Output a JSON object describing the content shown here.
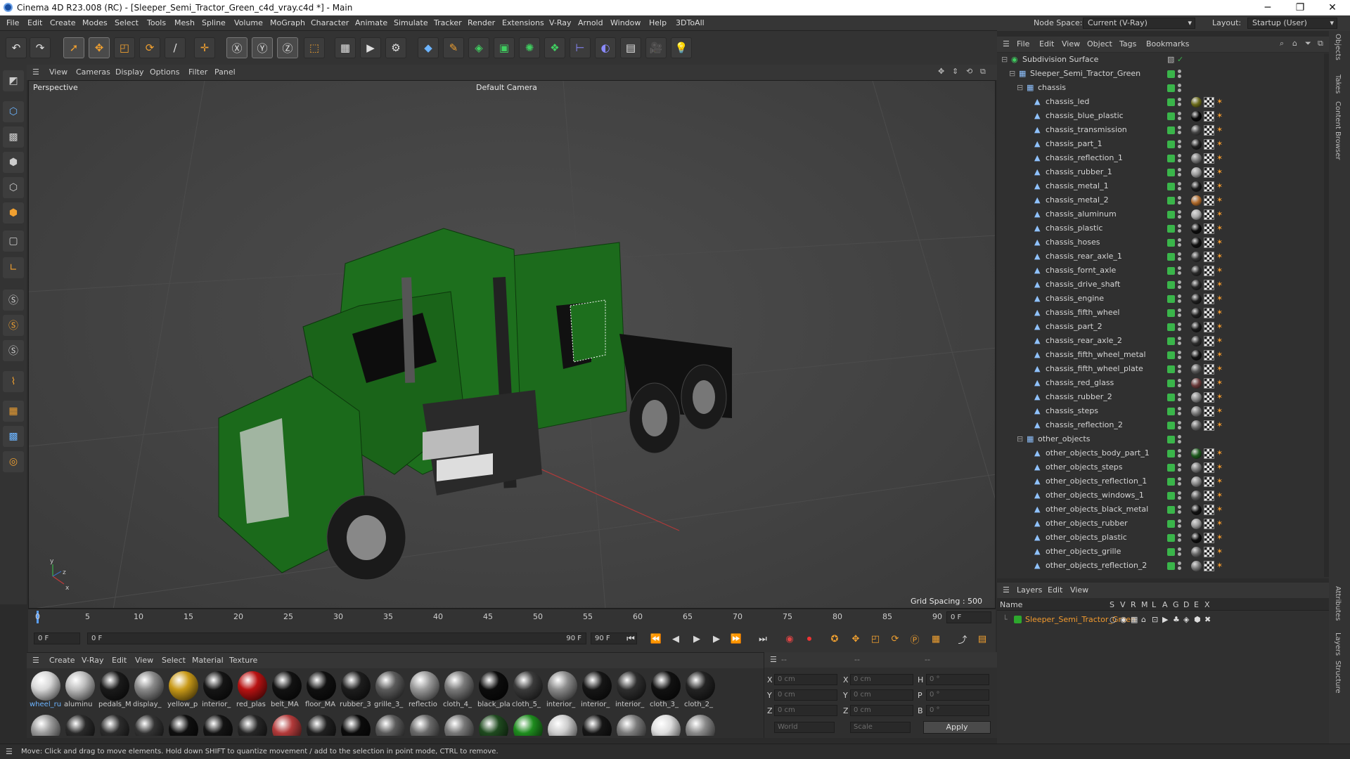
{
  "window": {
    "title": "Cinema 4D R23.008 (RC) - [Sleeper_Semi_Tractor_Green_c4d_vray.c4d *] - Main",
    "min": "─",
    "max": "❐",
    "close": "✕"
  },
  "menubar": [
    "File",
    "Edit",
    "Create",
    "Modes",
    "Select",
    "Tools",
    "Mesh",
    "Spline",
    "Volume",
    "MoGraph",
    "Character",
    "Animate",
    "Simulate",
    "Tracker",
    "Render",
    "Extensions",
    "V-Ray",
    "Arnold",
    "Window",
    "Help",
    "3DToAll"
  ],
  "nodespace": {
    "label": "Node Space:",
    "value": "Current (V-Ray)",
    "layout_label": "Layout:",
    "layout_value": "Startup (User)"
  },
  "viewport": {
    "menu": [
      "View",
      "Cameras",
      "Display",
      "Options",
      "Filter",
      "Panel"
    ],
    "name": "Perspective",
    "camera": "Default Camera",
    "grid_spacing": "Grid Spacing : 500 cm"
  },
  "timeline": {
    "ticks": [
      "0",
      "5",
      "10",
      "15",
      "20",
      "25",
      "30",
      "35",
      "40",
      "45",
      "50",
      "55",
      "60",
      "65",
      "70",
      "75",
      "80",
      "85",
      "90"
    ],
    "end_frame": "0 F",
    "start_field": "0 F",
    "current_field": "0 F",
    "range_end": "90 F",
    "max_field": "90 F"
  },
  "materials": {
    "menu": [
      "Create",
      "V-Ray",
      "Edit",
      "View",
      "Select",
      "Material",
      "Texture"
    ],
    "row1": [
      {
        "label": "wheel_ru",
        "color": "#d8d8d8"
      },
      {
        "label": "aluminu",
        "color": "#bdbdbd"
      },
      {
        "label": "pedals_M",
        "color": "#1a1a1a"
      },
      {
        "label": "display_",
        "color": "#8a8a8a"
      },
      {
        "label": "yellow_p",
        "color": "#c99a18"
      },
      {
        "label": "interior_",
        "color": "#151515"
      },
      {
        "label": "red_plas",
        "color": "#b81212"
      },
      {
        "label": "belt_MA",
        "color": "#121212"
      },
      {
        "label": "floor_MA",
        "color": "#101010"
      },
      {
        "label": "rubber_3",
        "color": "#1d1d1d"
      },
      {
        "label": "grille_3_",
        "color": "#5b5b5b"
      },
      {
        "label": "reflectio",
        "color": "#9a9a9a"
      },
      {
        "label": "cloth_4_",
        "color": "#7a7a7a"
      },
      {
        "label": "black_pla",
        "color": "#0c0c0c"
      },
      {
        "label": "cloth_5_",
        "color": "#3a3a3a"
      },
      {
        "label": "interior_",
        "color": "#8c8c8c"
      },
      {
        "label": "interior_",
        "color": "#161616"
      },
      {
        "label": "interior_",
        "color": "#2e2e2e"
      },
      {
        "label": "cloth_3_",
        "color": "#111111"
      },
      {
        "label": "cloth_2_",
        "color": "#232323"
      }
    ],
    "row2": [
      "#9a9a9a",
      "#2a2a2a",
      "#2c2c2c",
      "#333333",
      "#0f0f0f",
      "#141414",
      "#262626",
      "#b23a3a",
      "#202020",
      "#0b0b0b",
      "#5a5a5a",
      "#6a6a6a",
      "#777777",
      "#1f4a1f",
      "#1e8c1e",
      "#cccccc",
      "#161616",
      "#7a7a7a",
      "#dddddd",
      "#888888"
    ]
  },
  "coords": {
    "headers": [
      "--",
      "--",
      "--"
    ],
    "rows": [
      {
        "a": "X",
        "av": "0 cm",
        "b": "X",
        "bv": "0 cm",
        "c": "H",
        "cv": "0 °"
      },
      {
        "a": "Y",
        "av": "0 cm",
        "b": "Y",
        "bv": "0 cm",
        "c": "P",
        "cv": "0 °"
      },
      {
        "a": "Z",
        "av": "0 cm",
        "b": "Z",
        "bv": "0 cm",
        "c": "B",
        "cv": "0 °"
      }
    ],
    "mode": "World",
    "scale": "Scale",
    "apply": "Apply"
  },
  "status": "Move: Click and drag to move elements. Hold down SHIFT to quantize movement / add to the selection in point mode, CTRL to remove.",
  "objects": {
    "menu": [
      "File",
      "Edit",
      "View",
      "Object",
      "Tags",
      "Bookmarks"
    ],
    "items": [
      {
        "name": "Subdivision Surface",
        "indent": 0,
        "type": "sub",
        "tag": ""
      },
      {
        "name": "Sleeper_Semi_Tractor_Green",
        "indent": 1,
        "type": "null",
        "tag": ""
      },
      {
        "name": "chassis",
        "indent": 2,
        "type": "null",
        "tag": ""
      },
      {
        "name": "chassis_led",
        "indent": 3,
        "type": "obj",
        "tag": "#6b6b1a"
      },
      {
        "name": "chassis_blue_plastic",
        "indent": 3,
        "type": "obj",
        "tag": "#0a0a0a"
      },
      {
        "name": "chassis_transmission",
        "indent": 3,
        "type": "obj",
        "tag": "#444"
      },
      {
        "name": "chassis_part_1",
        "indent": 3,
        "type": "obj",
        "tag": "#222"
      },
      {
        "name": "chassis_reflection_1",
        "indent": 3,
        "type": "obj",
        "tag": "#777"
      },
      {
        "name": "chassis_rubber_1",
        "indent": 3,
        "type": "obj",
        "tag": "#999"
      },
      {
        "name": "chassis_metal_1",
        "indent": 3,
        "type": "obj",
        "tag": "#1c1c1c"
      },
      {
        "name": "chassis_metal_2",
        "indent": 3,
        "type": "obj",
        "tag": "#b06a2a"
      },
      {
        "name": "chassis_aluminum",
        "indent": 3,
        "type": "obj",
        "tag": "#aaa"
      },
      {
        "name": "chassis_plastic",
        "indent": 3,
        "type": "obj",
        "tag": "#0c0c0c"
      },
      {
        "name": "chassis_hoses",
        "indent": 3,
        "type": "obj",
        "tag": "#111"
      },
      {
        "name": "chassis_rear_axle_1",
        "indent": 3,
        "type": "obj",
        "tag": "#333"
      },
      {
        "name": "chassis_fornt_axle",
        "indent": 3,
        "type": "obj",
        "tag": "#2a2a2a"
      },
      {
        "name": "chassis_drive_shaft",
        "indent": 3,
        "type": "obj",
        "tag": "#262626"
      },
      {
        "name": "chassis_engine",
        "indent": 3,
        "type": "obj",
        "tag": "#1e1e1e"
      },
      {
        "name": "chassis_fifth_wheel",
        "indent": 3,
        "type": "obj",
        "tag": "#202020"
      },
      {
        "name": "chassis_part_2",
        "indent": 3,
        "type": "obj",
        "tag": "#1b1b1b"
      },
      {
        "name": "chassis_rear_axle_2",
        "indent": 3,
        "type": "obj",
        "tag": "#2d2d2d"
      },
      {
        "name": "chassis_fifth_wheel_metal",
        "indent": 3,
        "type": "obj",
        "tag": "#141414"
      },
      {
        "name": "chassis_fifth_wheel_plate",
        "indent": 3,
        "type": "obj",
        "tag": "#555"
      },
      {
        "name": "chassis_red_glass",
        "indent": 3,
        "type": "obj",
        "tag": "#6a3a3a"
      },
      {
        "name": "chassis_rubber_2",
        "indent": 3,
        "type": "obj",
        "tag": "#888"
      },
      {
        "name": "chassis_steps",
        "indent": 3,
        "type": "obj",
        "tag": "#777"
      },
      {
        "name": "chassis_reflection_2",
        "indent": 3,
        "type": "obj",
        "tag": "#666"
      },
      {
        "name": "other_objects",
        "indent": 2,
        "type": "null",
        "tag": ""
      },
      {
        "name": "other_objects_body_part_1",
        "indent": 3,
        "type": "obj",
        "tag": "#1e5a1e"
      },
      {
        "name": "other_objects_steps",
        "indent": 3,
        "type": "obj",
        "tag": "#777"
      },
      {
        "name": "other_objects_reflection_1",
        "indent": 3,
        "type": "obj",
        "tag": "#888"
      },
      {
        "name": "other_objects_windows_1",
        "indent": 3,
        "type": "obj",
        "tag": "#555"
      },
      {
        "name": "other_objects_black_metal",
        "indent": 3,
        "type": "obj",
        "tag": "#111"
      },
      {
        "name": "other_objects_rubber",
        "indent": 3,
        "type": "obj",
        "tag": "#999"
      },
      {
        "name": "other_objects_plastic",
        "indent": 3,
        "type": "obj",
        "tag": "#0e0e0e"
      },
      {
        "name": "other_objects_grille",
        "indent": 3,
        "type": "obj",
        "tag": "#666"
      },
      {
        "name": "other_objects_reflection_2",
        "indent": 3,
        "type": "obj",
        "tag": "#777"
      }
    ]
  },
  "layers": {
    "menu": [
      "Layers",
      "Edit",
      "View"
    ],
    "cols_label": "Name",
    "cols": [
      "S",
      "V",
      "R",
      "M",
      "L",
      "A",
      "G",
      "D",
      "E",
      "X"
    ],
    "layer_name": "Sleeper_Semi_Tractor_Green",
    "layer_color": "#2da82d"
  },
  "sidetabs": [
    "Objects",
    "Takes",
    "Content Browser",
    "Attributes",
    "Layers",
    "Structure"
  ]
}
